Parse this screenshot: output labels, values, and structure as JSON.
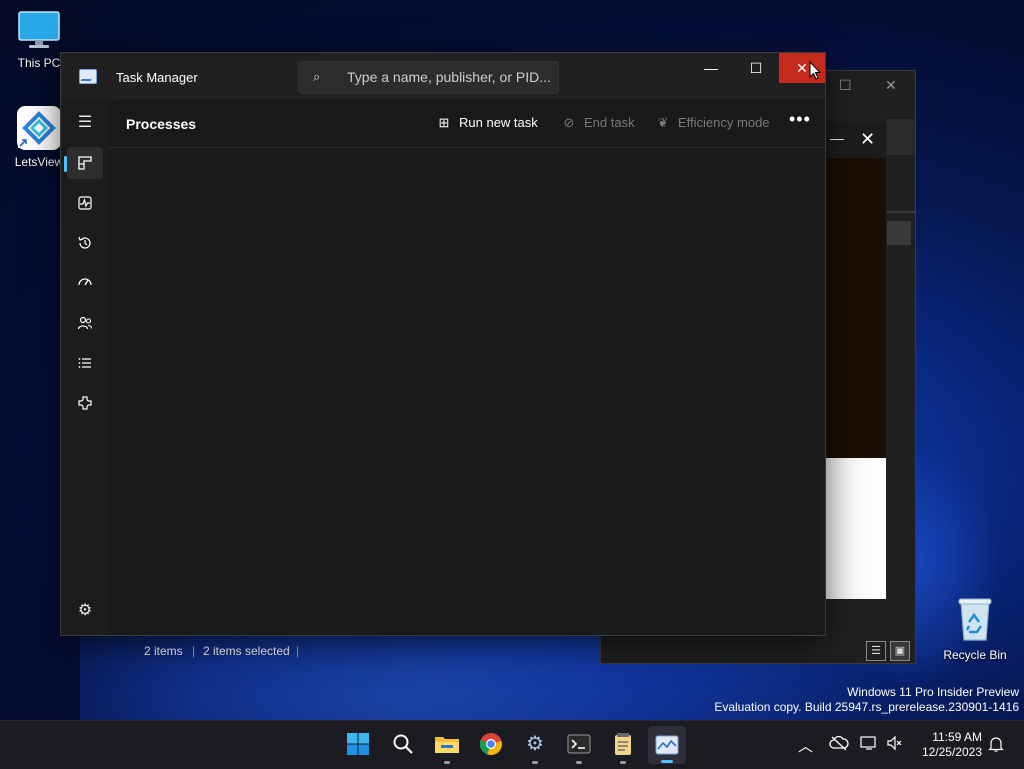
{
  "desktop": {
    "icons": [
      {
        "label": "This PC",
        "icon": "monitor-icon"
      },
      {
        "label": "LetsView",
        "icon": "letsview-icon"
      },
      {
        "label": "Recycle Bin",
        "icon": "recycle-bin-icon"
      }
    ],
    "watermark": {
      "line1": "Windows 11 Pro Insider Preview",
      "line2": "Evaluation copy. Build 25947.rs_prerelease.230901-1416"
    }
  },
  "task_manager": {
    "title": "Task Manager",
    "search_placeholder": "Type a name, publisher, or PID...",
    "window_controls": {
      "minimize": "—",
      "maximize": "☐",
      "close": "✕"
    },
    "heading": "Processes",
    "toolbar": {
      "run_new_task": "Run new task",
      "end_task": "End task",
      "efficiency_mode": "Efficiency mode",
      "more": "•••"
    },
    "nav": [
      {
        "name": "menu",
        "icon": "hamburger-icon"
      },
      {
        "name": "processes",
        "icon": "processes-icon",
        "active": true
      },
      {
        "name": "performance",
        "icon": "performance-icon"
      },
      {
        "name": "app-history",
        "icon": "history-icon"
      },
      {
        "name": "startup-apps",
        "icon": "startup-icon"
      },
      {
        "name": "users",
        "icon": "users-icon"
      },
      {
        "name": "details",
        "icon": "details-list-icon"
      },
      {
        "name": "services",
        "icon": "services-icon"
      },
      {
        "name": "settings",
        "icon": "gear-icon"
      }
    ]
  },
  "background_window": {
    "status": {
      "items": "2 items",
      "separator": "|",
      "selected": "2 items selected"
    }
  },
  "taskbar": {
    "apps": [
      "start-icon",
      "search-icon",
      "file-explorer-icon",
      "chrome-icon",
      "settings-icon",
      "terminal-icon",
      "notepad-icon",
      "task-manager-icon"
    ],
    "clock": {
      "time": "11:59 AM",
      "date": "12/25/2023"
    }
  }
}
